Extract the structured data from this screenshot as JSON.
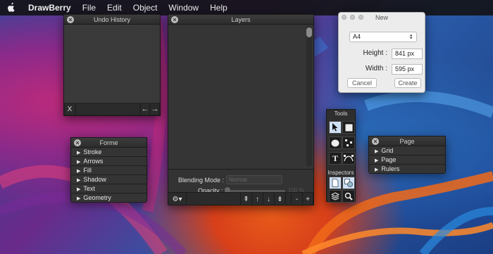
{
  "menubar": {
    "app_name": "DrawBerry",
    "items": [
      "File",
      "Edit",
      "Object",
      "Window",
      "Help"
    ]
  },
  "undo_history": {
    "title": "Undo History",
    "clear_label": "X",
    "back_label": "←",
    "forward_label": "→"
  },
  "layers": {
    "title": "Layers",
    "blending_label": "Blending Mode :",
    "blending_value": "Normal",
    "opacity_label": "Opacity :",
    "opacity_value": "100 %",
    "footer_buttons": [
      "⇞",
      "↑",
      "↓",
      "⇟",
      "-",
      "+"
    ]
  },
  "new_document": {
    "title": "New",
    "format": "A4",
    "height_label": "Height :",
    "height_value": "841 px",
    "width_label": "Width :",
    "width_value": "595 px",
    "cancel_label": "Cancel",
    "create_label": "Create"
  },
  "forme": {
    "title": "Forme",
    "items": [
      "Stroke",
      "Arrows",
      "Fill",
      "Shadow",
      "Text",
      "Geometry"
    ]
  },
  "page": {
    "title": "Page",
    "items": [
      "Grid",
      "Page",
      "Rulers"
    ]
  },
  "tools": {
    "title": "Tools",
    "inspectors_label": "Inspectors",
    "items": [
      "pointer-icon",
      "rectangle-icon",
      "oval-icon",
      "nodes-icon",
      "text-icon",
      "bezier-icon"
    ],
    "inspector_items": [
      "document-icon",
      "layers-icon",
      "zoom-icon"
    ]
  },
  "colors": {
    "panel_bg": "#333333",
    "menubar_bg": "#141418",
    "selected_tool": "#cfe0f5"
  }
}
